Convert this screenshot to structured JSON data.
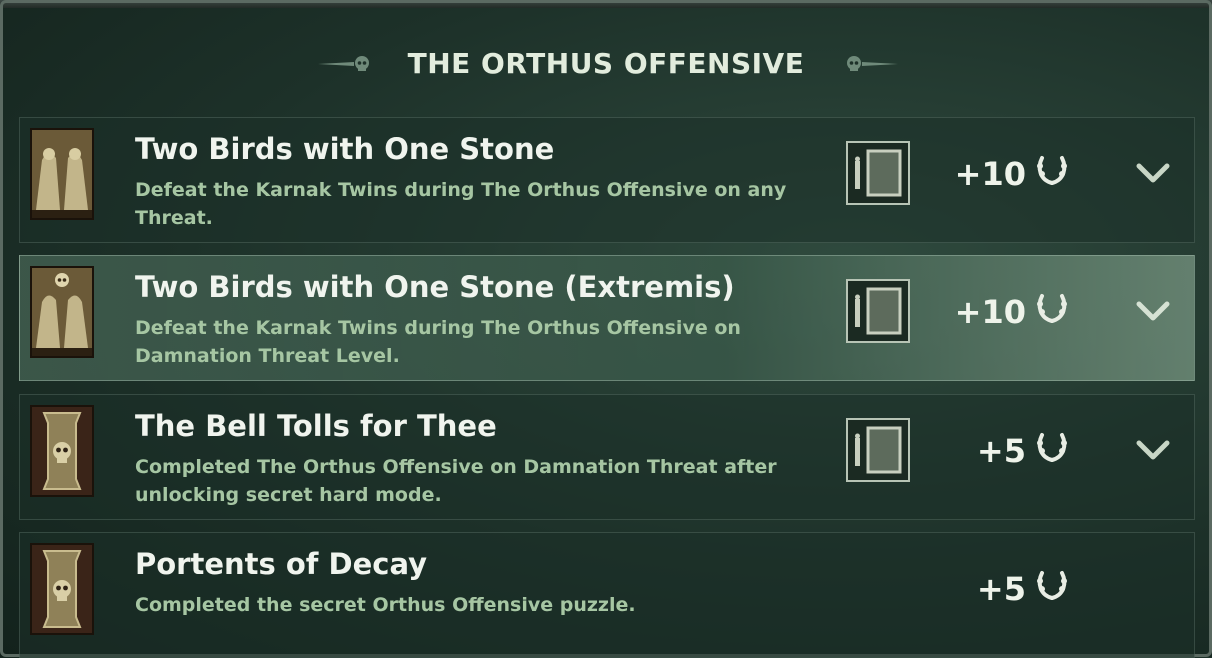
{
  "header": {
    "title": "THE ORTHUS OFFENSIVE"
  },
  "achievements": [
    {
      "title": "Two Birds with One Stone",
      "description": "Defeat the Karnak Twins during The Orthus Offensive on any Threat.",
      "points": "+10",
      "has_reward": true,
      "expandable": true,
      "highlighted": false
    },
    {
      "title": "Two Birds with One Stone (Extremis)",
      "description": "Defeat the Karnak Twins during The Orthus Offensive on Damnation Threat Level.",
      "points": "+10",
      "has_reward": true,
      "expandable": true,
      "highlighted": true
    },
    {
      "title": "The Bell Tolls for Thee",
      "description": "Completed The Orthus Offensive on Damnation Threat after unlocking secret hard mode.",
      "points": "+5",
      "has_reward": true,
      "expandable": true,
      "highlighted": false
    },
    {
      "title": "Portents of Decay",
      "description": "Completed the secret Orthus Offensive puzzle.",
      "points": "+5",
      "has_reward": false,
      "expandable": false,
      "highlighted": false
    }
  ],
  "icons": {
    "row_icons": [
      "twin-statues-icon",
      "twin-statues-skull-icon",
      "skull-pillar-icon",
      "skull-pillar-icon"
    ],
    "reward_icon": "frame-reward-icon",
    "points_icon": "laurel-wreath-icon",
    "expand_icon": "chevron-down-icon",
    "title_ornament": "skull-ornament-icon"
  },
  "colors": {
    "background": "#1d3129",
    "title_text": "#e2ecdd",
    "description_text": "#a6c6a3",
    "highlight_row": "#3c5c4c"
  }
}
